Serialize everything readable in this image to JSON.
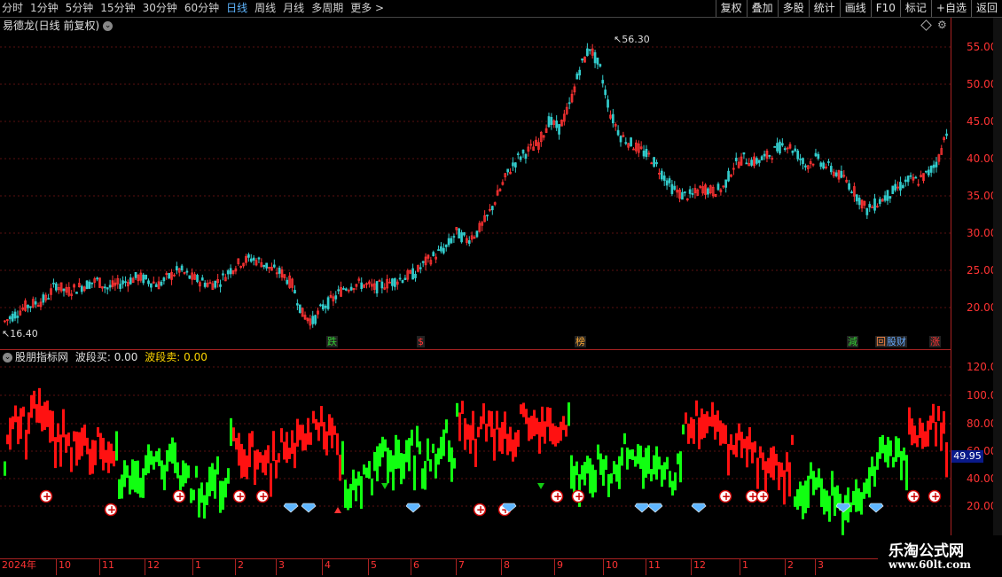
{
  "toolbar": {
    "periods": [
      "分时",
      "1分钟",
      "5分钟",
      "15分钟",
      "30分钟",
      "60分钟",
      "日线",
      "周线",
      "月线",
      "多周期",
      "更多 >"
    ],
    "active_period": "日线",
    "right_buttons": [
      "复权",
      "叠加",
      "多股",
      "统计",
      "画线",
      "F10",
      "标记",
      "+自选",
      "返回"
    ]
  },
  "stock": {
    "title": "易德龙(日线 前复权)"
  },
  "price_axis": [
    "55.00",
    "50.00",
    "45.00",
    "40.00",
    "35.00",
    "30.00",
    "25.00",
    "20.00"
  ],
  "annotations": {
    "high": "56.30",
    "low": "16.40"
  },
  "events": [
    {
      "label": "跌",
      "color": "#33cc33"
    },
    {
      "label": "$",
      "color": "#ff3333"
    },
    {
      "label": "榜",
      "color": "#ffaa33"
    },
    {
      "label": "減",
      "color": "#33cc33"
    },
    {
      "label": "回",
      "color": "#ff8844"
    },
    {
      "label": "股",
      "color": "#66aaff"
    },
    {
      "label": "财",
      "color": "#66aaff"
    },
    {
      "label": "涨",
      "color": "#ff3333"
    }
  ],
  "indicator": {
    "name": "股朋指标网",
    "buy_label": "波段买:",
    "buy_value": "0.00",
    "sell_label": "波段卖:",
    "sell_value": "0.00",
    "current_value": "49.95"
  },
  "indicator_axis": [
    "120.0",
    "100.0",
    "80.00",
    "60.00",
    "40.00",
    "20.00"
  ],
  "time_axis": [
    "2024年",
    "10",
    "11",
    "12",
    "1",
    "2",
    "3",
    "4",
    "5",
    "6",
    "7",
    "8",
    "9",
    "10",
    "11",
    "12",
    "1",
    "2",
    "3"
  ],
  "watermark": {
    "name": "乐淘公式网",
    "url": "www.60lt.com"
  },
  "colors": {
    "up": "#ff3333",
    "down": "#33cccc",
    "ind_up": "#ff1111",
    "ind_down": "#11ff11",
    "axis": "#aa2222"
  },
  "chart_data": {
    "type": "candlestick",
    "ylim": [
      15,
      58
    ],
    "close_trend": [
      18,
      19,
      20,
      20.5,
      21,
      23,
      22,
      22.5,
      23,
      23.5,
      22.5,
      23,
      23.5,
      24,
      23.5,
      23,
      24,
      25,
      24,
      23.5,
      23,
      23.5,
      25,
      26,
      26.5,
      26,
      25,
      24.5,
      23,
      19,
      18,
      20,
      21,
      22.5,
      23,
      23,
      22.5,
      23,
      23.5,
      24,
      24.5,
      26,
      27,
      28,
      30,
      29,
      30,
      32,
      35,
      38,
      40,
      41,
      42,
      45,
      44,
      47,
      52,
      55,
      52,
      46,
      43,
      42,
      41,
      40,
      38,
      36,
      35,
      35,
      36,
      35.5,
      36,
      39,
      40,
      39.5,
      40,
      41,
      42,
      41,
      39,
      40,
      39,
      38,
      37,
      35,
      33,
      34,
      35,
      36,
      37,
      37,
      38,
      40,
      45
    ],
    "indicator_ylim": [
      0,
      125
    ]
  }
}
